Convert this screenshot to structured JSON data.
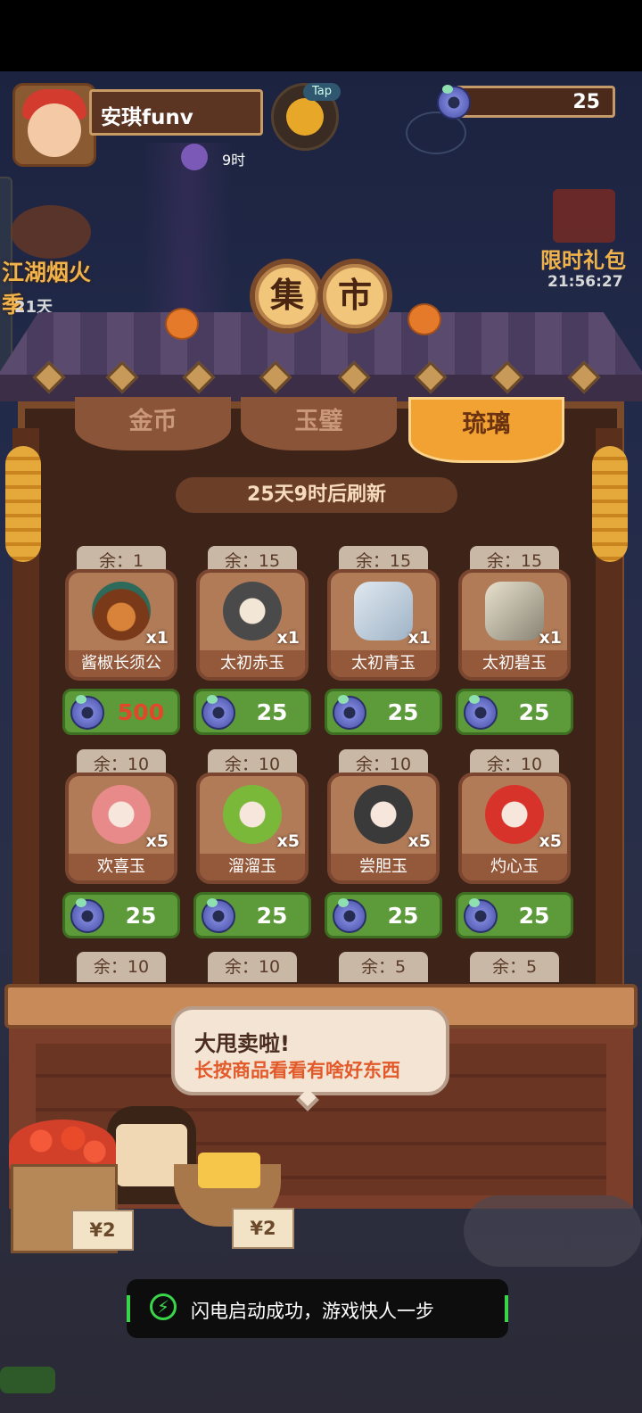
{
  "player": {
    "name": "安琪funv",
    "timer": "9时"
  },
  "tap_label": "Tap",
  "currency": {
    "amount": "25"
  },
  "promo_left": {
    "title": "江湖烟火季",
    "countdown": "21天"
  },
  "promo_right": {
    "title": "限时礼包",
    "countdown": "21:56:27"
  },
  "shop": {
    "title_chars": [
      "集",
      "市"
    ],
    "tabs": [
      {
        "label": "金币",
        "active": false
      },
      {
        "label": "玉璧",
        "active": false
      },
      {
        "label": "琉璃",
        "active": true
      }
    ],
    "refresh_text": "25天9时后刷新",
    "items": [
      {
        "stock": "余：1",
        "name": "酱椒长须公",
        "qty": "x1",
        "price": "500",
        "price_color": "#e2472a",
        "icon": "dish-icon"
      },
      {
        "stock": "余：15",
        "name": "太初赤玉",
        "qty": "x1",
        "price": "25",
        "price_color": "#ffffff",
        "icon": "red-jade-ore-icon"
      },
      {
        "stock": "余：15",
        "name": "太初青玉",
        "qty": "x1",
        "price": "25",
        "price_color": "#ffffff",
        "icon": "blue-jade-ore-icon"
      },
      {
        "stock": "余：15",
        "name": "太初碧玉",
        "qty": "x1",
        "price": "25",
        "price_color": "#ffffff",
        "icon": "green-jade-ore-icon"
      },
      {
        "stock": "余：10",
        "name": "欢喜玉",
        "qty": "x5",
        "price": "25",
        "price_color": "#ffffff",
        "icon": "pink-jade-icon"
      },
      {
        "stock": "余：10",
        "name": "溜溜玉",
        "qty": "x5",
        "price": "25",
        "price_color": "#ffffff",
        "icon": "green-jade-icon"
      },
      {
        "stock": "余：10",
        "name": "尝胆玉",
        "qty": "x5",
        "price": "25",
        "price_color": "#ffffff",
        "icon": "black-jade-icon"
      },
      {
        "stock": "余：10",
        "name": "灼心玉",
        "qty": "x5",
        "price": "25",
        "price_color": "#ffffff",
        "icon": "red-jade-icon"
      }
    ],
    "next_row_stock": [
      "余：10",
      "余：10",
      "余：5",
      "余：5"
    ]
  },
  "speech_bubble": {
    "line1": "大甩卖啦!",
    "line2": "长按商品看看有啥好东西"
  },
  "stall_tags": [
    "¥2",
    "¥2"
  ],
  "toast": {
    "text": "闪电启动成功，游戏快人一步"
  }
}
